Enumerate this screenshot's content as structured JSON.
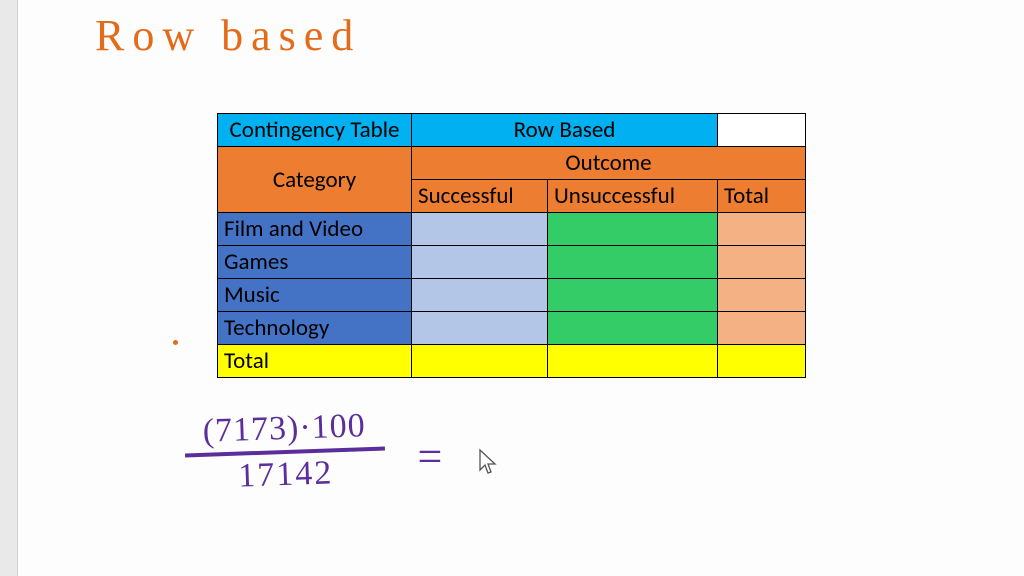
{
  "title": "Row based",
  "table": {
    "headerA": "Contingency Table",
    "headerB": "Row Based",
    "categoryLabel": "Category",
    "outcomeLabel": "Outcome",
    "col1": "Successful",
    "col2": "Unsuccessful",
    "col3": "Total",
    "rows": [
      "Film and Video",
      "Games",
      "Music",
      "Technology"
    ],
    "totalLabel": "Total"
  },
  "formula": {
    "numerator": "(7173)·100",
    "denominator": "17142",
    "equals": "="
  },
  "chart_data": {
    "type": "table",
    "title": "Contingency Table — Row Based",
    "columns": [
      "Category",
      "Successful",
      "Unsuccessful",
      "Total"
    ],
    "rows": [
      {
        "Category": "Film and Video",
        "Successful": null,
        "Unsuccessful": null,
        "Total": null
      },
      {
        "Category": "Games",
        "Successful": null,
        "Unsuccessful": null,
        "Total": null
      },
      {
        "Category": "Music",
        "Successful": null,
        "Unsuccessful": null,
        "Total": null
      },
      {
        "Category": "Technology",
        "Successful": null,
        "Unsuccessful": null,
        "Total": null
      },
      {
        "Category": "Total",
        "Successful": null,
        "Unsuccessful": null,
        "Total": null
      }
    ],
    "annotation_formula": "(7173 * 100) / 17142"
  }
}
